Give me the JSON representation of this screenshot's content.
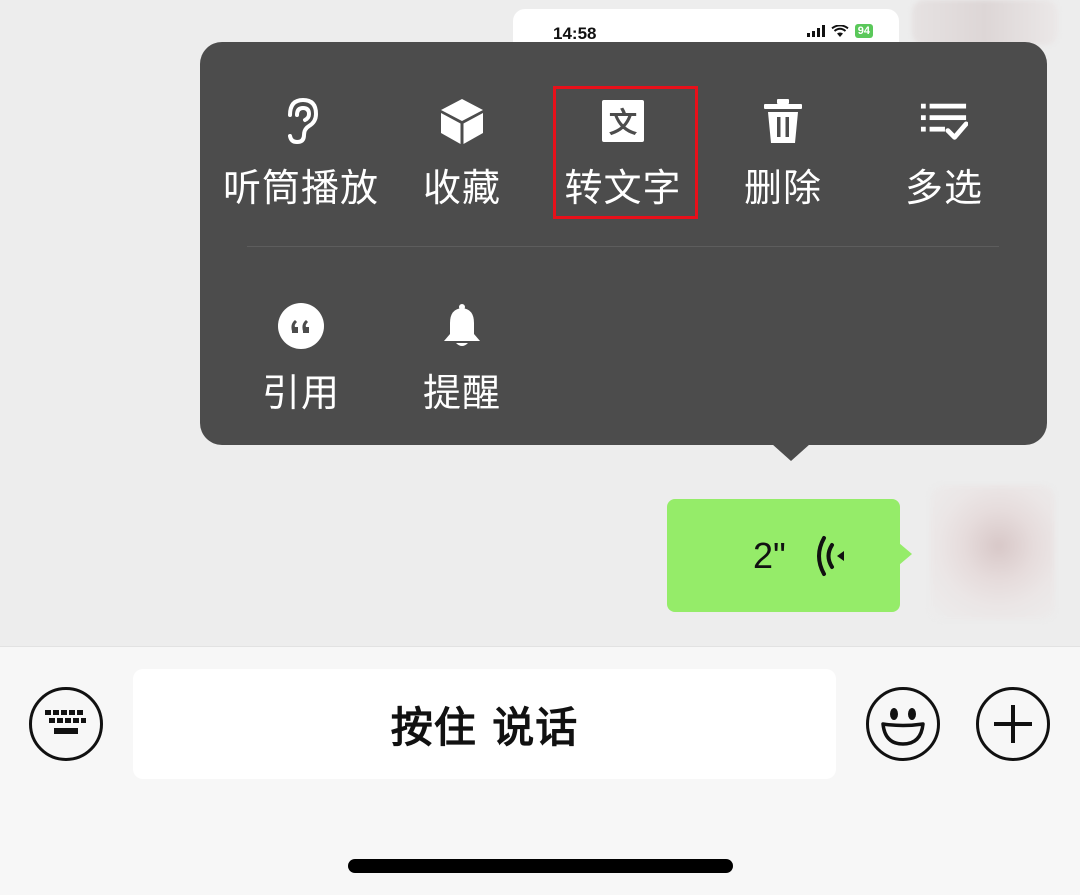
{
  "previous_message": {
    "status_time": "14:58",
    "battery_label": "94"
  },
  "popup_menu": {
    "items": [
      {
        "label": "听筒播放",
        "icon": "ear-icon"
      },
      {
        "label": "收藏",
        "icon": "cube-icon"
      },
      {
        "label": "转文字",
        "icon": "translate-text-icon"
      },
      {
        "label": "删除",
        "icon": "trash-icon"
      },
      {
        "label": "多选",
        "icon": "multi-select-icon"
      },
      {
        "label": "引用",
        "icon": "quote-icon"
      },
      {
        "label": "提醒",
        "icon": "bell-icon"
      }
    ],
    "translate_icon_glyph": "文",
    "highlighted_item": "转文字",
    "highlight_color": "#e8101a",
    "background_color": "#4c4c4c"
  },
  "voice_message": {
    "duration": "2\"",
    "bubble_color": "#95ec69"
  },
  "input_bar": {
    "hold_to_talk_label": "按住 说话",
    "left_button": "keyboard-icon",
    "emoji_button": "emoji-icon",
    "more_button": "plus-icon"
  }
}
